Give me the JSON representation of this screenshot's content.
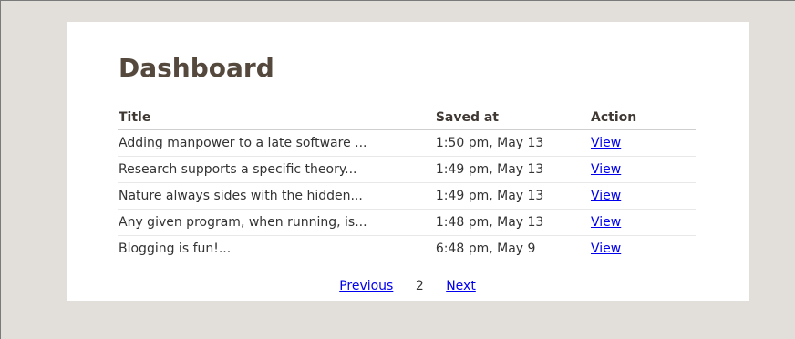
{
  "page_title": "Dashboard",
  "table": {
    "headers": {
      "title": "Title",
      "saved_at": "Saved at",
      "action": "Action"
    },
    "rows": [
      {
        "title": "Adding manpower to a late software ...",
        "saved_at": "1:50 pm, May 13",
        "action": "View"
      },
      {
        "title": "Research supports a specific theory...",
        "saved_at": "1:49 pm, May 13",
        "action": "View"
      },
      {
        "title": "Nature always sides with the hidden...",
        "saved_at": "1:49 pm, May 13",
        "action": "View"
      },
      {
        "title": "Any given program, when running, is...",
        "saved_at": "1:48 pm, May 13",
        "action": "View"
      },
      {
        "title": "Blogging is fun!...",
        "saved_at": "6:48 pm, May 9",
        "action": "View"
      }
    ]
  },
  "pagination": {
    "previous_label": "Previous",
    "current_page": "2",
    "next_label": "Next"
  },
  "colors": {
    "page_background": "#e2dfda",
    "panel_background": "#ffffff",
    "title_color": "#55483d",
    "link_color": "#0000ee"
  }
}
